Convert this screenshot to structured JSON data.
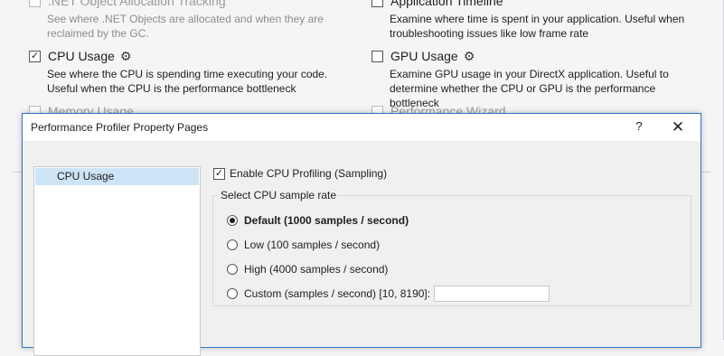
{
  "background": {
    "tools": [
      {
        "name": "",
        "checked": false,
        "description": "See where .NET Objects are allocated and when they are reclaimed by the GC."
      },
      {
        "name": "Application Timeline",
        "checked": false,
        "description": "Examine where time is spent in your application. Useful when troubleshooting issues like low frame rate"
      },
      {
        "name": "CPU Usage",
        "checked": true,
        "description": "See where the CPU is spending time executing your code. Useful when the CPU is the performance bottleneck"
      },
      {
        "name": "GPU Usage",
        "checked": false,
        "description": "Examine GPU usage in your DirectX application. Useful to determine whether the CPU or GPU is the performance bottleneck"
      },
      {
        "name": "Memory Usage",
        "checked": false
      },
      {
        "name": "Performance Wizard",
        "checked": false
      }
    ],
    "net_alloc_name": ".NET Object Allocation Tracking"
  },
  "dialog": {
    "title": "Performance Profiler Property Pages",
    "help_label": "?",
    "close_label": "✕",
    "nav": [
      {
        "label": "CPU Usage",
        "selected": true
      }
    ],
    "enable_label": "Enable CPU Profiling (Sampling)",
    "enable_checked": true,
    "group_label": "Select CPU sample rate",
    "rates": [
      {
        "label": "Default (1000 samples / second)",
        "selected": true
      },
      {
        "label": "Low (100 samples / second)",
        "selected": false
      },
      {
        "label": "High (4000 samples / second)",
        "selected": false
      },
      {
        "label": "Custom (samples / second) [10, 8190]:",
        "selected": false
      }
    ],
    "custom_value": ""
  },
  "icons": {
    "check": "✓",
    "gear": "⚙"
  }
}
